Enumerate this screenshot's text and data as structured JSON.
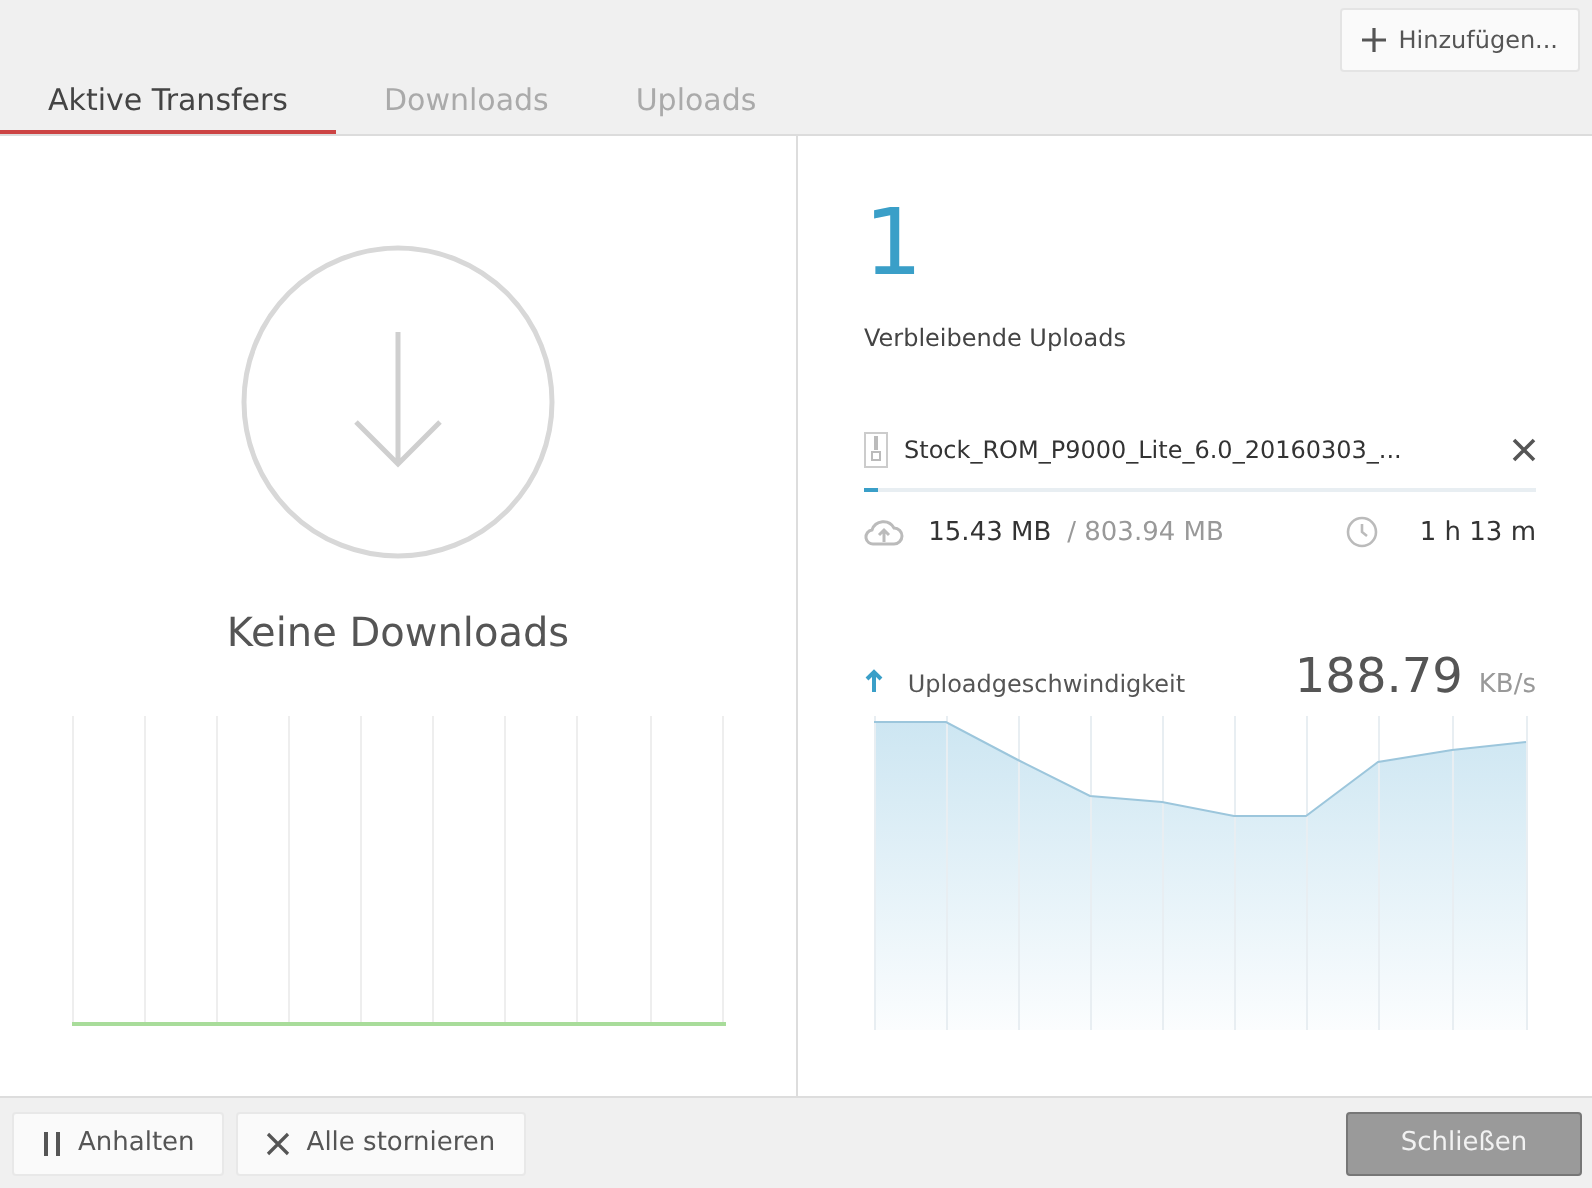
{
  "add_button": {
    "label": "Hinzufügen..."
  },
  "tabs": [
    {
      "label": "Aktive Transfers",
      "selected": true
    },
    {
      "label": "Downloads",
      "selected": false
    },
    {
      "label": "Uploads",
      "selected": false
    }
  ],
  "downloads": {
    "empty_text": "Keine Downloads"
  },
  "uploads": {
    "remaining_count": "1",
    "remaining_label": "Verbleibende Uploads",
    "file": {
      "name": "Stock_ROM_P9000_Lite_6.0_20160303_...",
      "level": 0.02,
      "transferred": "15.43 MB",
      "total": "/ 803.94 MB",
      "time_left": "1 h 13 m"
    },
    "speed_label": "Uploadgeschwindigkeit",
    "speed_value": "188.79",
    "speed_unit": "KB/s"
  },
  "footer_buttons": [
    {
      "kind": "pause",
      "label": "Anhalten"
    },
    {
      "kind": "cancel",
      "label": "Alle stornieren"
    },
    {
      "kind": "close",
      "label": "Schließen"
    }
  ]
}
